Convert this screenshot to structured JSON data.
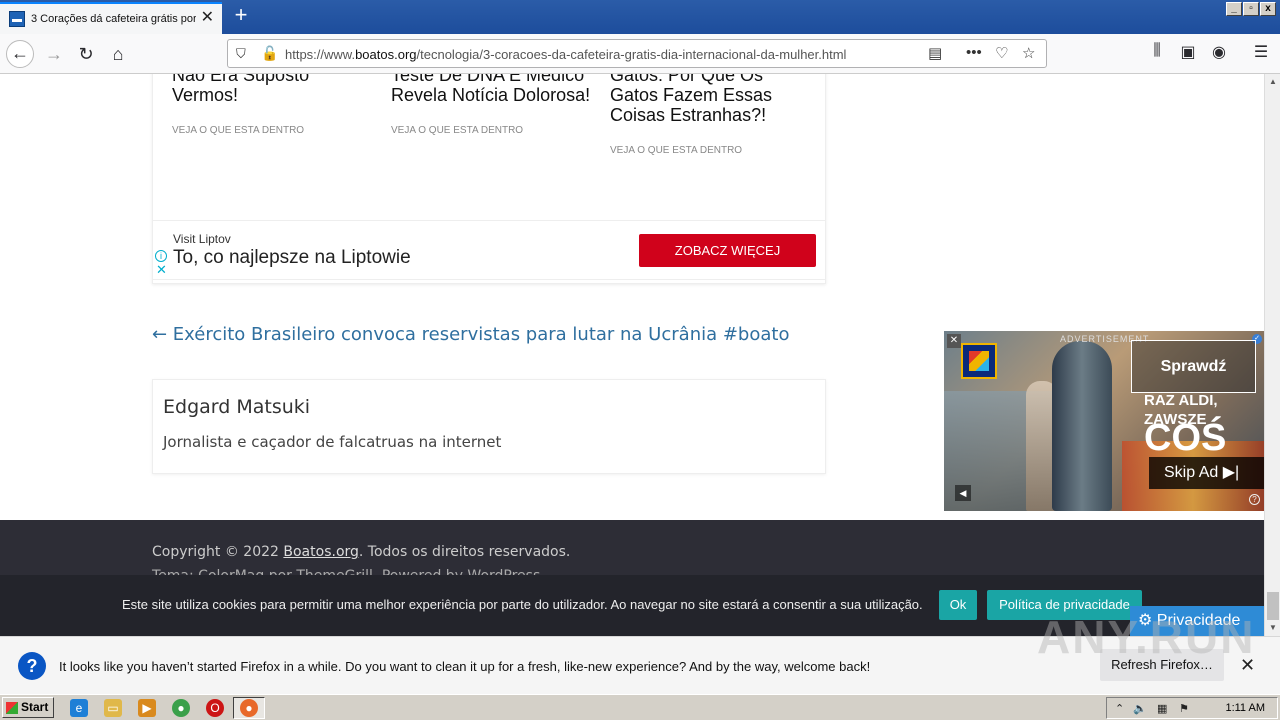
{
  "browser": {
    "tab_title": "3 Corações dá cafeteira grátis por",
    "new_tab": "+",
    "url_prefix": "https://www.",
    "url_domain": "boatos.org",
    "url_path": "/tecnologia/3-coracoes-da-cafeteira-gratis-dia-internacional-da-mulher.html",
    "window_controls": [
      "_",
      "▫",
      "x"
    ]
  },
  "recommendations": [
    {
      "title": "Não Era Suposto Vermos!",
      "link": "VEJA O QUE ESTA DENTRO"
    },
    {
      "title": "Teste De DNA E Médico Revela Notícia Dolorosa!",
      "link": "VEJA O QUE ESTA DENTRO"
    },
    {
      "title": "Gatos: Por Que Os Gatos Fazem Essas Coisas Estranhas?!",
      "link": "VEJA O QUE ESTA DENTRO"
    }
  ],
  "ad_banner": {
    "sponsor": "Visit Liptov",
    "headline": "To, co najlepsze na Liptowie",
    "cta": "ZOBACZ WIĘCEJ"
  },
  "prev_post": "← Exército Brasileiro convoca reservistas para lutar na Ucrânia #boato",
  "author": {
    "name": "Edgard Matsuki",
    "bio": "Jornalista e caçador de falcatruas na internet"
  },
  "footer": {
    "copyright_pre": "Copyright © 2022 ",
    "copyright_link": "Boatos.org",
    "copyright_post": ". Todos os direitos reservados.",
    "theme": "Tema: ColorMag por ThemeGrill. Powered by WordPress."
  },
  "video_ad": {
    "label": "ADVERTISEMENT",
    "cta": "Sprawdź",
    "slogan_line1": "RAZ ALDI,",
    "slogan_line2": "ZAWSZE",
    "slogan_big": "COŚ",
    "skip": "Skip Ad"
  },
  "cookie": {
    "text": "Este site utiliza cookies para permitir uma melhor experiência por parte do utilizador. Ao navegar no site estará a consentir a sua utilização.",
    "ok": "Ok",
    "policy": "Política de privacidade",
    "privacy_button": "Privacidade"
  },
  "notification": {
    "message": "It looks like you haven’t started Firefox in a while. Do you want to clean it up for a fresh, like-new experience? And by the way, welcome back!",
    "refresh_button": "Refresh Firefox…"
  },
  "watermark": "ANY.RUN",
  "taskbar": {
    "start": "Start",
    "clock": "1:11 AM"
  }
}
